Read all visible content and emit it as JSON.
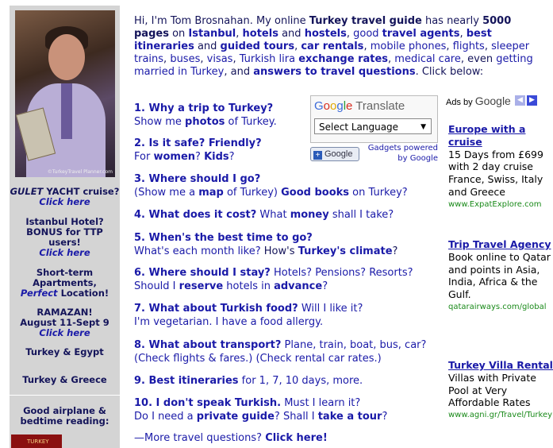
{
  "sidebar": {
    "photo_credit": "©TurkeyTravel Planner.com",
    "items": [
      {
        "line1": "GULET",
        "line1b": " YACHT cruise?",
        "click": "Click here"
      },
      {
        "line1": "Istanbul Hotel?",
        "line2": "BONUS for TTP",
        "line3": "users!",
        "click": "Click here"
      },
      {
        "line1": "Short-term",
        "line2": "Apartments,",
        "line3a": "Perfect",
        "line3b": " Location!"
      },
      {
        "line1": "RAMAZAN!",
        "line2": "August 11-Sept 9",
        "click": "Click here"
      },
      {
        "line1": "Turkey & Egypt"
      },
      {
        "line1": "Turkey & Greece"
      },
      {
        "line1": "Good airplane &",
        "line2": "bedtime reading:"
      }
    ],
    "book_label": "TURKEY"
  },
  "intro": {
    "t1": "Hi, I'm Tom Brosnahan. My online ",
    "guide": "Turkey travel guide",
    "t2": " has nearly ",
    "count": "5000 pages",
    "t3": " on ",
    "istanbul": "Istanbul",
    "c1": ", ",
    "hotels": "hotels",
    "and1": " and ",
    "hostels": "hostels",
    "c2": ", ",
    "good": "good ",
    "agents": "travel agents",
    "c3": ", ",
    "best": "best itineraries",
    "and2": " and ",
    "tours": "guided tours",
    "c4": ", ",
    "cars": "car rentals",
    "c5": ", ",
    "mobile": "mobile phones",
    "c6": ", ",
    "flights": "flights",
    "c7": ", ",
    "trains": "sleeper trains",
    "c8": ", ",
    "buses": "buses",
    "c9": ", ",
    "visas": "visas",
    "c10": ", ",
    "lira": "Turkish lira ",
    "rates": "exchange rates",
    "c11": ", ",
    "medical": "medical care",
    "c12": ", even ",
    "married": "getting married in Turkey",
    "c13": ", and ",
    "answers": "answers to travel questions",
    "t4": ". Click below:"
  },
  "questions": [
    {
      "h": "1. Why a trip to Turkey?",
      "s1": "Show me ",
      "s2": "photos",
      "s3": " of Turkey."
    },
    {
      "h": "2. Is it safe? Friendly?",
      "s1": "For ",
      "s2": "women",
      "s3": "? ",
      "s4": "Kids",
      "s5": "?"
    },
    {
      "h": "3. Where should I go?",
      "s1": "(Show me a ",
      "s2": "map",
      "s3": " of Turkey) ",
      "s4": "Good books",
      "s5": " on Turkey?"
    },
    {
      "h": "4. What does it cost?",
      "s1": " What ",
      "s2": "money",
      "s3": " shall I take?"
    },
    {
      "h": "5. When's the best time to go?",
      "s1": "What's each month like?",
      "s2": " How's ",
      "s3": "Turkey's climate",
      "s4": "?"
    },
    {
      "h": "6. Where should I stay?",
      "s1": " Hotels? Pensions? Resorts?",
      "s2": "Should I ",
      "s3": "reserve",
      "s4": " hotels in ",
      "s5": "advance",
      "s6": "?"
    },
    {
      "h": "7. What about Turkish food?",
      "s1": " Will I like it?",
      "s2": "I'm vegetarian. I have a food allergy."
    },
    {
      "h": "8. What about transport?",
      "s1": " Plane, train, boat, bus, car?",
      "s2": "(Check flights & fares.) (Check rental car rates.)"
    },
    {
      "h": "9. Best itineraries",
      "s1": " for 1, 7, 10 days, more."
    },
    {
      "h": "10. I don't speak Turkish.",
      "s1": " Must I learn it?",
      "s2": "Do I need a ",
      "s3": "private guide",
      "s4": "? Shall I ",
      "s5": "take a tour",
      "s6": "?"
    }
  ],
  "more": {
    "t1": "—More travel questions? ",
    "t2": "Click here!"
  },
  "translate": {
    "logo_g": "G",
    "logo_o1": "o",
    "logo_o2": "o",
    "logo_g2": "g",
    "logo_l": "l",
    "logo_e": "e",
    "logo_word": "Translate",
    "select_value": "Select Language",
    "button_label": "Google",
    "gadgets_text": "Gadgets powered by Google"
  },
  "ads": {
    "ads_by": "Ads by",
    "google": "Google",
    "items": [
      {
        "title": "Europe with a cruise",
        "body": "15 Days from £699 with 2 day cruise France, Swiss, Italy and Greece",
        "url": "www.ExpatExplore.com"
      },
      {
        "title": "Trip Travel Agency",
        "body": "Book online to Qatar and points in Asia, India, Africa & the Gulf.",
        "url": "qatarairways.com/global"
      },
      {
        "title": "Turkey Villa Rental",
        "body": "Villas with Private Pool at Very Affordable Rates",
        "url": "www.agni.gr/Travel/Turkey"
      }
    ]
  }
}
